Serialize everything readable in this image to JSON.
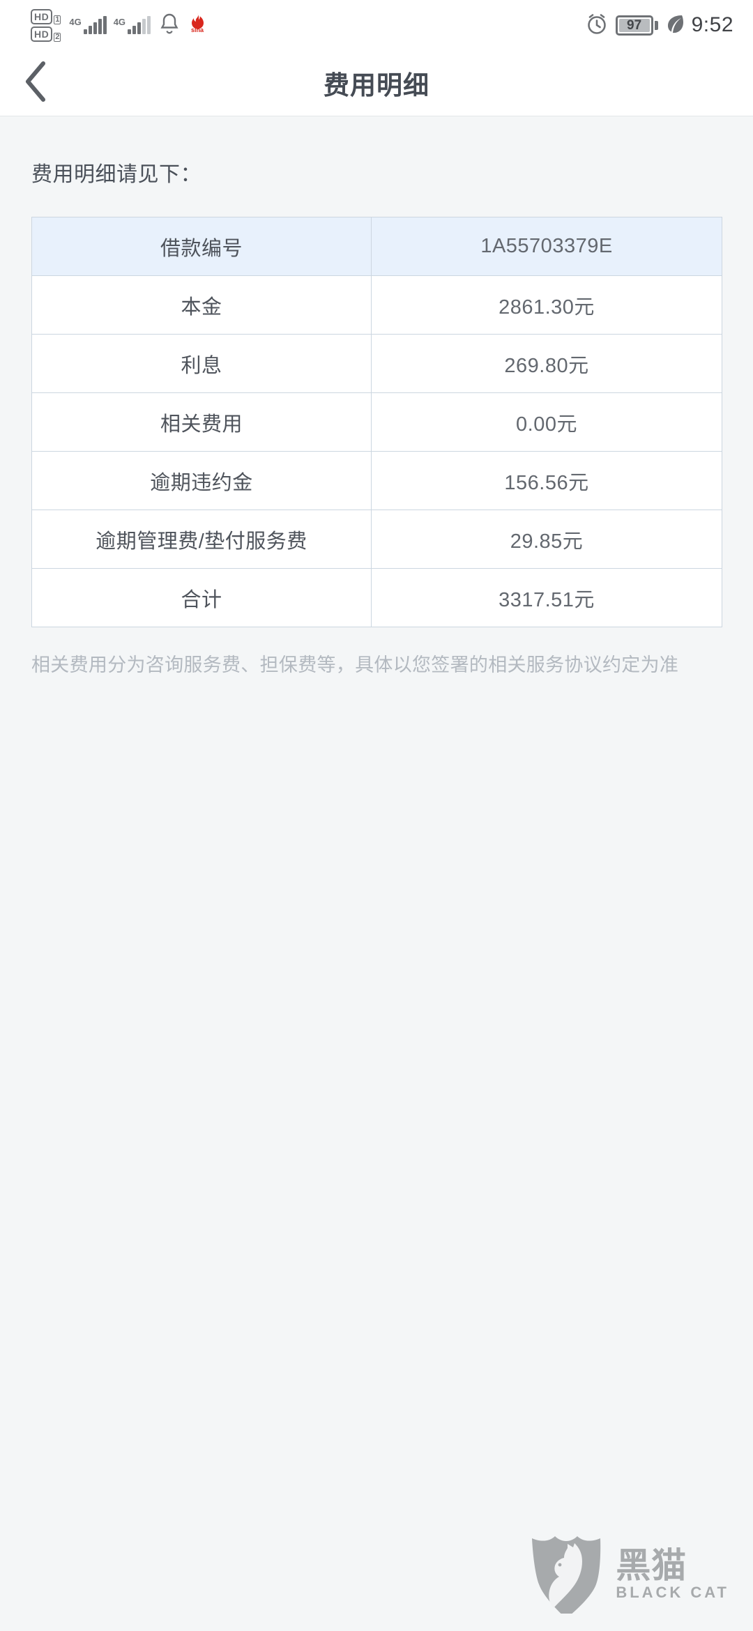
{
  "status_bar": {
    "hd_primary": "HD",
    "hd_primary_sim": "1",
    "hd_secondary": "HD",
    "hd_secondary_sim": "2",
    "network_primary": "4G",
    "network_secondary": "4G",
    "battery_percent": "97",
    "time": "9:52",
    "icons": [
      "hd-icon",
      "signal-bars-icon",
      "alarm-icon",
      "sina-weibo-icon",
      "battery-icon",
      "leaf-power-saving-icon"
    ]
  },
  "nav": {
    "title": "费用明细",
    "back_label": "返回"
  },
  "main": {
    "lead_text": "费用明细请见下：",
    "table": {
      "header": {
        "label": "借款编号",
        "value": "1A55703379E"
      },
      "rows": [
        {
          "label": "本金",
          "value": "2861.30元"
        },
        {
          "label": "利息",
          "value": "269.80元"
        },
        {
          "label": "相关费用",
          "value": "0.00元"
        },
        {
          "label": "逾期违约金",
          "value": "156.56元"
        },
        {
          "label": "逾期管理费/垫付服务费",
          "value": "29.85元"
        },
        {
          "label": "合计",
          "value": "3317.51元"
        }
      ]
    },
    "footnote": "相关费用分为咨询服务费、担保费等，具体以您签署的相关服务协议约定为准"
  },
  "watermark": {
    "name_cn": "黑猫",
    "name_en": "BLACK CAT"
  },
  "colors": {
    "page_background": "#f4f6f7",
    "header_row_background": "#e8f1fc",
    "table_border": "#ccd6e0",
    "title_text": "#454b54",
    "footnote_text": "#b3b9c0"
  }
}
